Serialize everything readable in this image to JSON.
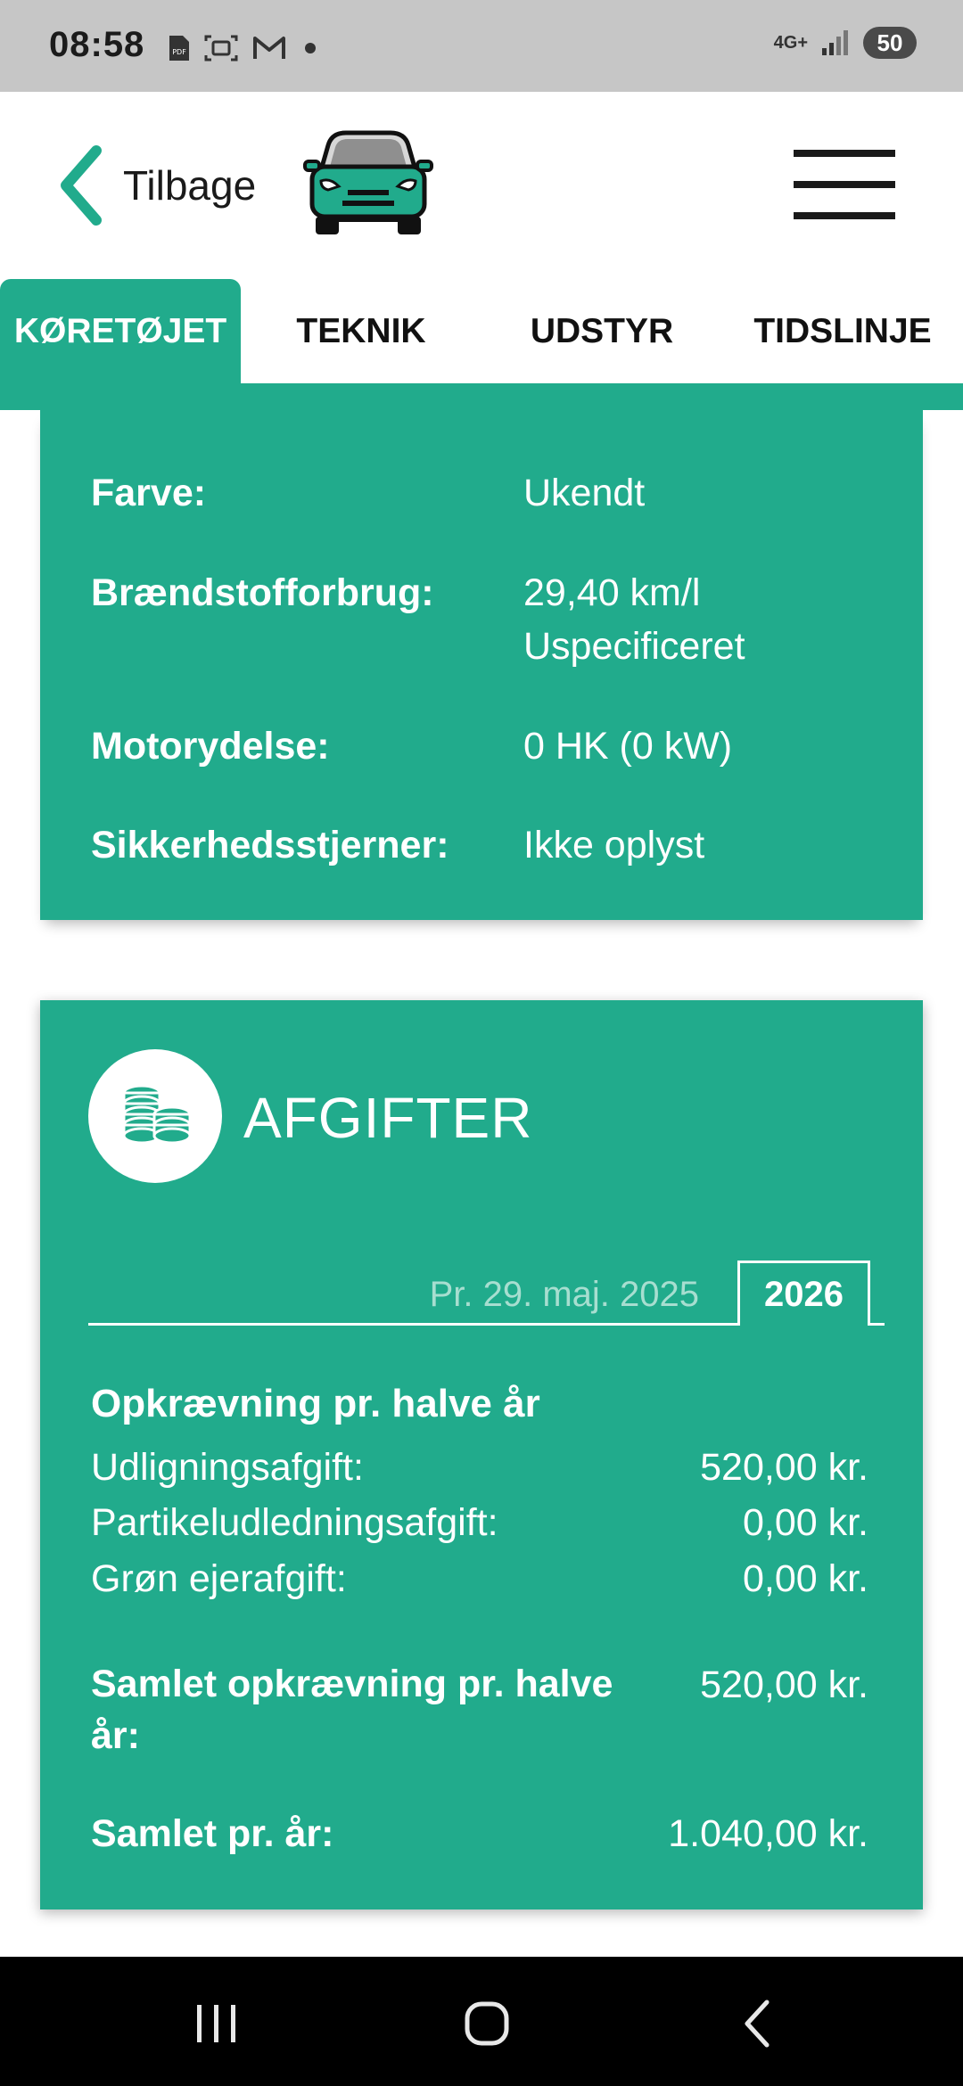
{
  "status_bar": {
    "time": "08:58",
    "network": "4G+",
    "battery": "50",
    "icons": [
      "pdf-icon",
      "screenshot-icon",
      "gmail-icon",
      "dot-icon",
      "signal-icon"
    ]
  },
  "header": {
    "back_label": "Tilbage",
    "logo_icon": "car-icon",
    "menu_icon": "hamburger-icon"
  },
  "tabs": [
    {
      "label": "KØRETØJET",
      "active": true
    },
    {
      "label": "TEKNIK",
      "active": false
    },
    {
      "label": "UDSTYR",
      "active": false
    },
    {
      "label": "TIDSLINJE",
      "active": false
    }
  ],
  "vehicle_details": [
    {
      "label": "Farve:",
      "value": "Ukendt"
    },
    {
      "label": "Brændstofforbrug:",
      "value_line1": "29,40 km/l",
      "value_line2": "Uspecificeret"
    },
    {
      "label": "Motorydelse:",
      "value": "0 HK (0 kW)"
    },
    {
      "label": "Sikkerhedsstjerner:",
      "value": "Ikke oplyst"
    }
  ],
  "taxes": {
    "title": "AFGIFTER",
    "icon": "coins-icon",
    "period_prev": "Pr. 29. maj. 2025",
    "period_active": "2026",
    "heading": "Opkrævning pr. halve år",
    "rows": [
      {
        "label": "Udligningsafgift:",
        "value": "520,00 kr."
      },
      {
        "label": "Partikeludledningsafgift:",
        "value": "0,00 kr."
      },
      {
        "label": "Grøn ejerafgift:",
        "value": "0,00 kr."
      }
    ],
    "total_half_label_1": "Samlet opkrævning pr. halve",
    "total_half_label_2": "år:",
    "total_half_value": "520,00 kr.",
    "total_year_label": "Samlet pr. år:",
    "total_year_value": "1.040,00 kr."
  },
  "colors": {
    "accent": "#21ab8c",
    "status_bar": "#c6c6c6",
    "nav_bar": "#000000"
  },
  "nav": [
    "recents-icon",
    "home-icon",
    "back-icon"
  ]
}
